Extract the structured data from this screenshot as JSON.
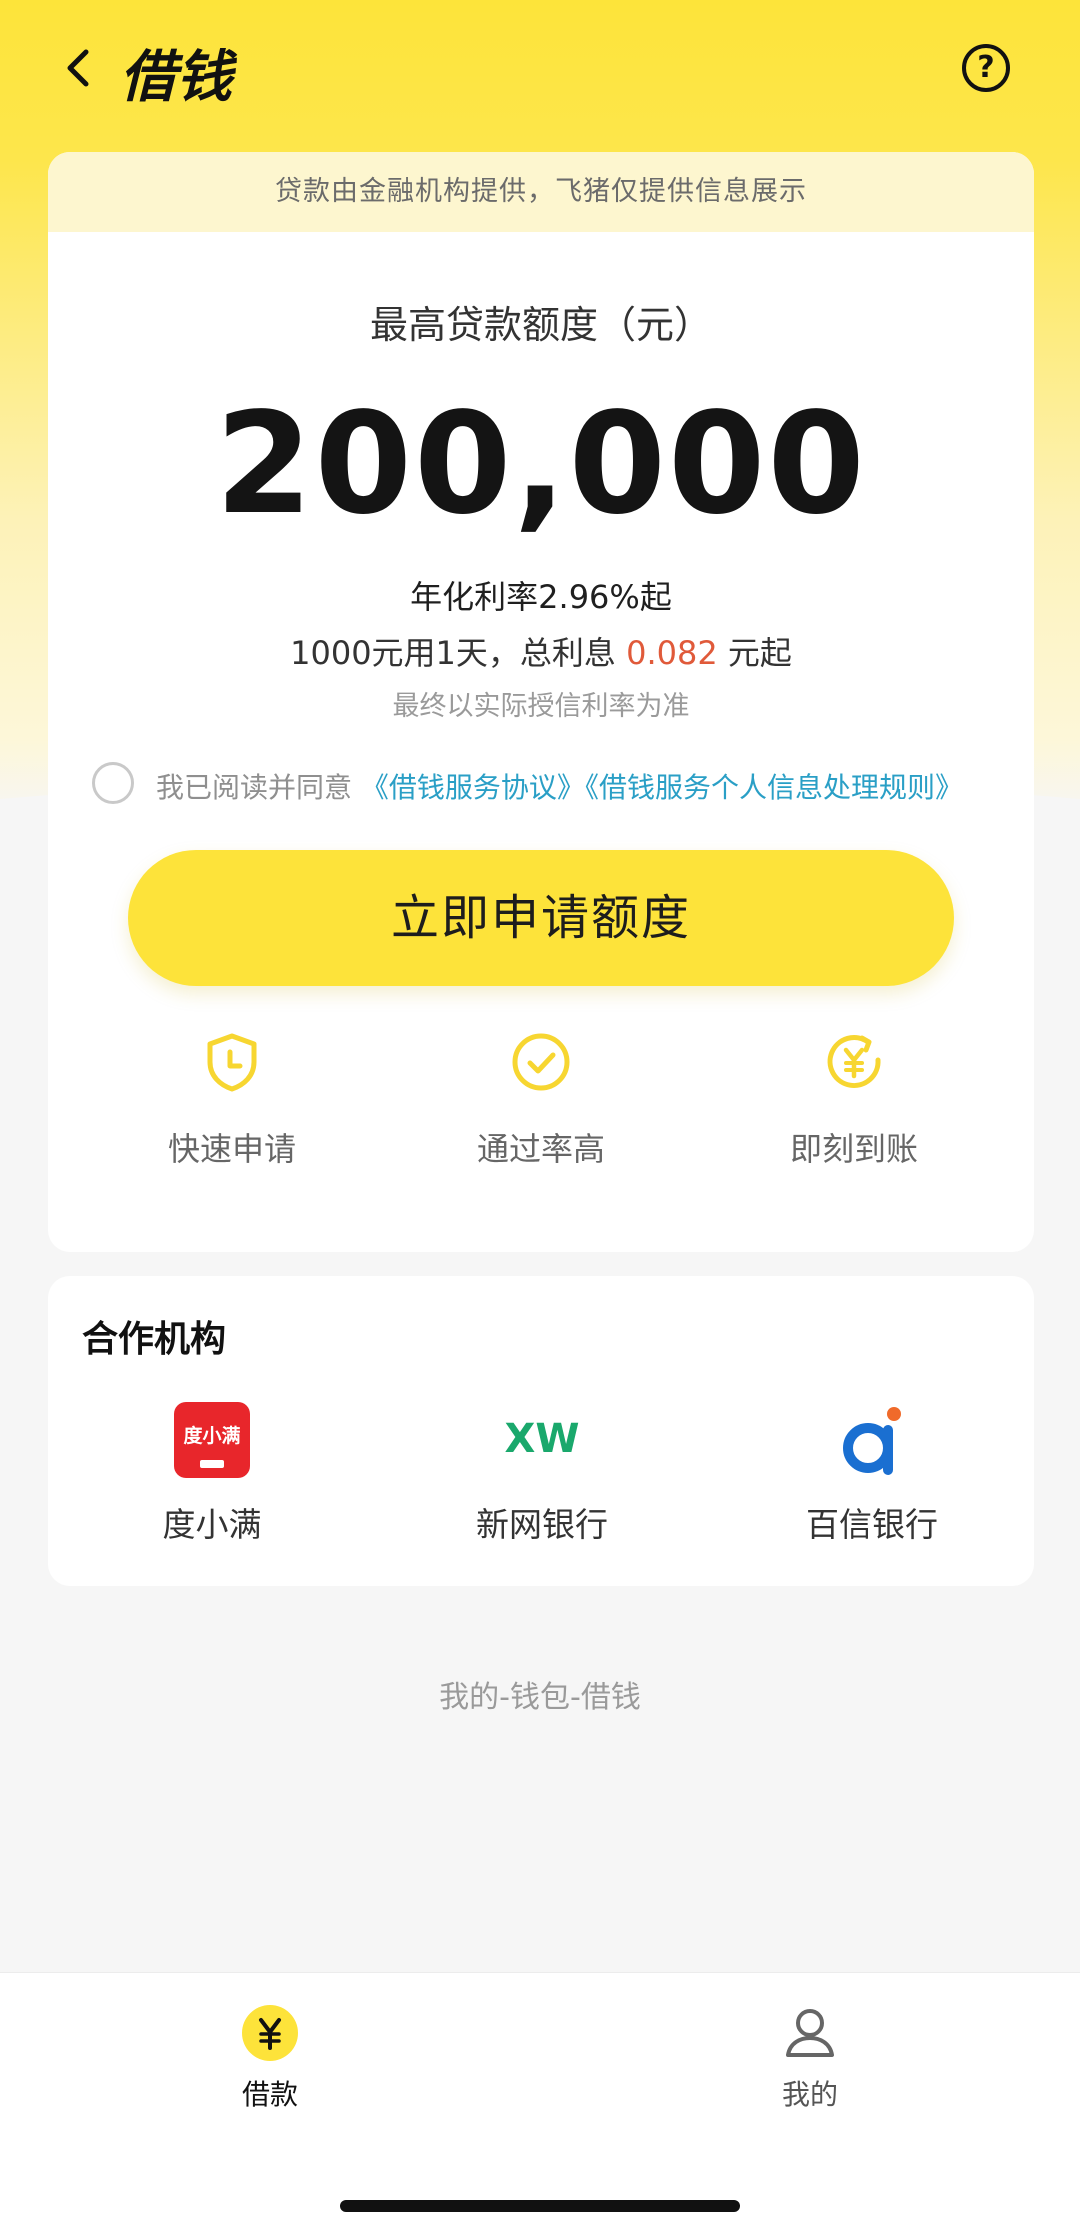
{
  "header": {
    "title": "借钱"
  },
  "notice": "贷款由金融机构提供，飞猪仅提供信息展示",
  "limit": {
    "label": "最高贷款额度（元）",
    "amount": "200,000",
    "rate": "年化利率2.96%起",
    "interest_prefix": "1000元用1天，总利息",
    "interest_value": "0.082",
    "interest_suffix": "元起",
    "disclaimer": "最终以实际授信利率为准"
  },
  "agreement": {
    "prefix": "我已阅读并同意",
    "link1": "《借钱服务协议》",
    "link2": "《借钱服务个人信息处理规则》"
  },
  "apply_button": "立即申请额度",
  "features": [
    {
      "label": "快速申请",
      "icon": "shield-clock-icon"
    },
    {
      "label": "通过率高",
      "icon": "check-circle-icon"
    },
    {
      "label": "即刻到账",
      "icon": "yuan-refresh-icon"
    }
  ],
  "partners": {
    "title": "合作机构",
    "items": [
      {
        "name": "度小满",
        "logo_text": "度小满",
        "icon": "duxiaoman-logo"
      },
      {
        "name": "新网银行",
        "logo_text": "XW",
        "icon": "xinwang-logo"
      },
      {
        "name": "百信银行",
        "logo_text": "",
        "icon": "baixin-logo"
      }
    ]
  },
  "path_text": "我的-钱包-借钱",
  "tabbar": [
    {
      "label": "借款",
      "icon": "yuan-icon",
      "active": true
    },
    {
      "label": "我的",
      "icon": "user-icon",
      "active": false
    }
  ],
  "colors": {
    "accent_yellow": "#fde33a",
    "link_blue": "#2a9fc6",
    "highlight_red": "#e05a3a",
    "feature_icon": "#f7d631"
  }
}
